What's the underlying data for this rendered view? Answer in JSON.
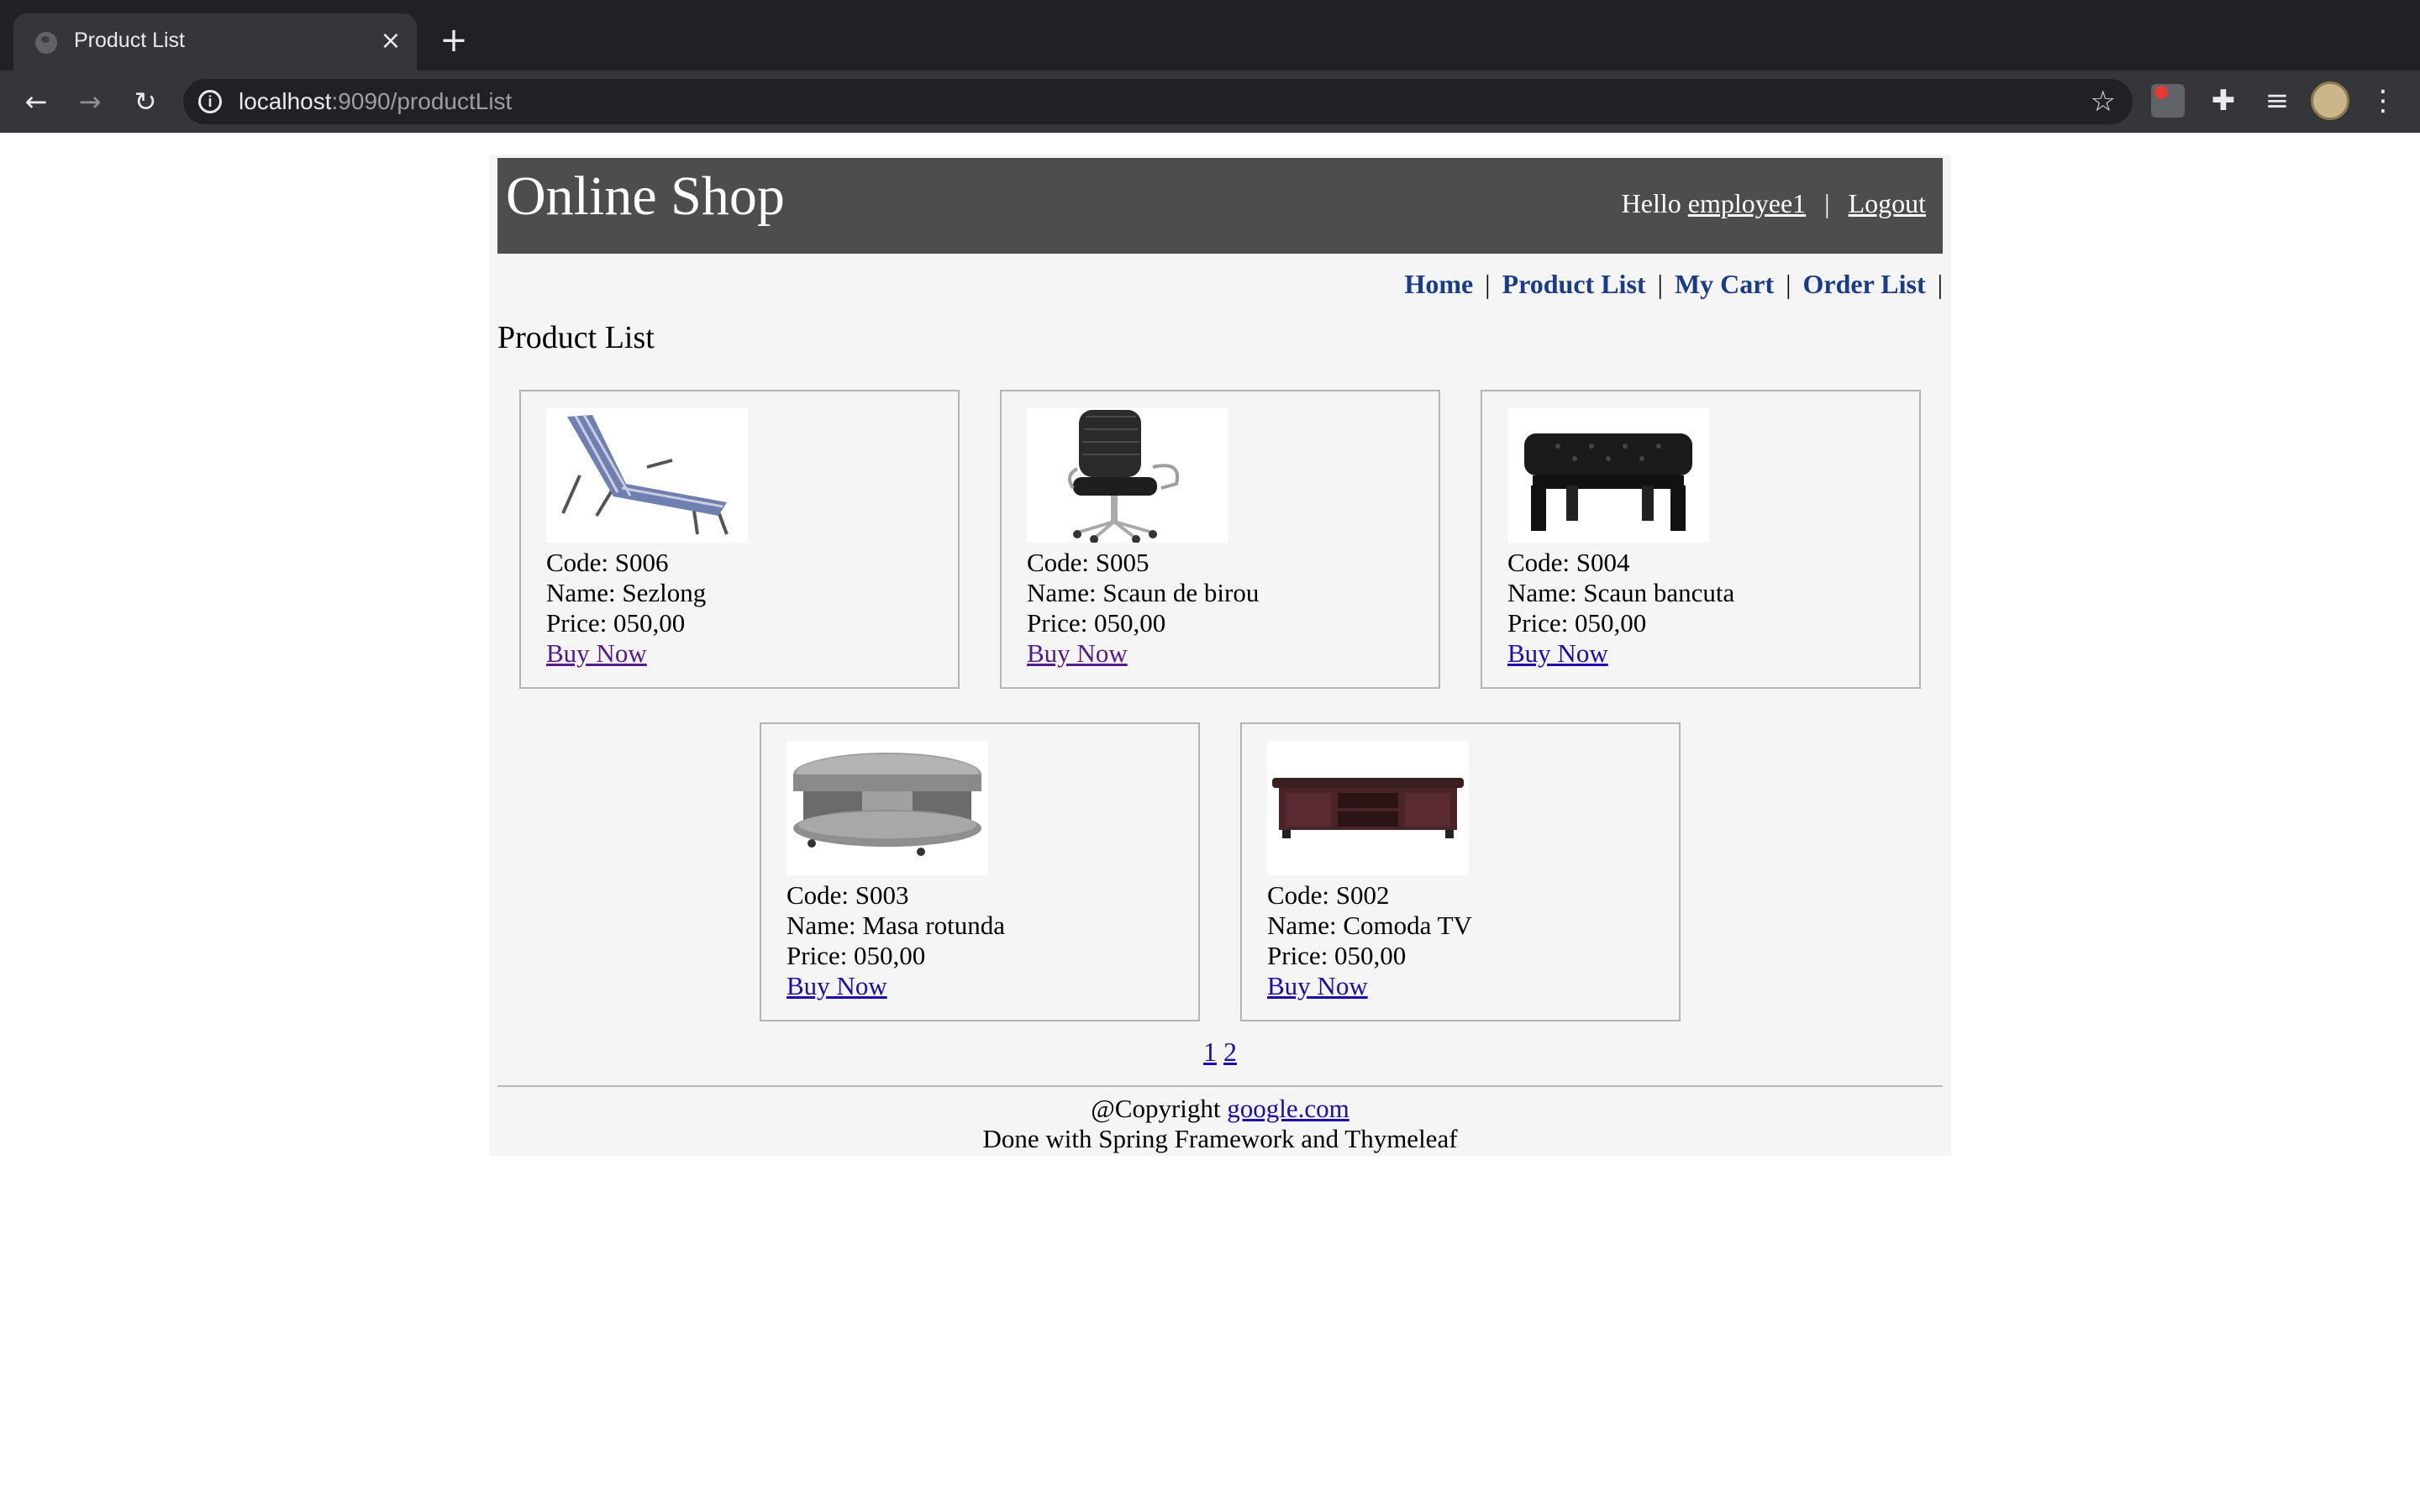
{
  "browser": {
    "tab_title": "Product List",
    "url_host": "localhost",
    "url_rest": ":9090/productList"
  },
  "header": {
    "site_title": "Online Shop",
    "greeting": "Hello",
    "username": "employee1",
    "separator": "|",
    "logout": "Logout"
  },
  "menu": {
    "items": [
      "Home",
      "Product List",
      "My Cart",
      "Order List"
    ],
    "separator": "|"
  },
  "page_heading": "Product List",
  "products": [
    {
      "code": "Code: S006",
      "name": "Name: Sezlong",
      "price": "Price: 050,00",
      "buy": "Buy Now"
    },
    {
      "code": "Code: S005",
      "name": "Name: Scaun de birou",
      "price": "Price: 050,00",
      "buy": "Buy Now"
    },
    {
      "code": "Code: S004",
      "name": "Name: Scaun bancuta",
      "price": "Price: 050,00",
      "buy": "Buy Now"
    },
    {
      "code": "Code: S003",
      "name": "Name: Masa rotunda",
      "price": "Price: 050,00",
      "buy": "Buy Now"
    },
    {
      "code": "Code: S002",
      "name": "Name: Comoda TV",
      "price": "Price: 050,00",
      "buy": "Buy Now"
    }
  ],
  "pagination": {
    "pages": [
      "1",
      "2"
    ]
  },
  "footer": {
    "copyright_prefix": "@Copyright",
    "copyright_link": "google.com",
    "credits": "Done with Spring Framework and Thymeleaf"
  }
}
